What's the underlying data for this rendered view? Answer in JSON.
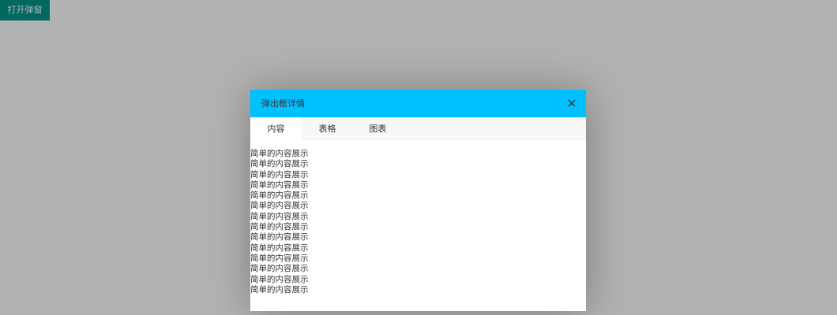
{
  "page": {
    "open_button_label": "打开弹窗"
  },
  "dialog": {
    "title": "弹出框详情",
    "close_icon": "close-icon",
    "tabs": [
      {
        "label": "内容",
        "active": true
      },
      {
        "label": "表格",
        "active": false
      },
      {
        "label": "图表",
        "active": false
      }
    ],
    "content_lines": [
      "简单的内容展示",
      "简单的内容展示",
      "简单的内容展示",
      "简单的内容展示",
      "简单的内容展示",
      "简单的内容展示",
      "简单的内容展示",
      "简单的内容展示",
      "简单的内容展示",
      "简单的内容展示",
      "简单的内容展示",
      "简单的内容展示",
      "简单的内容展示",
      "简单的内容展示"
    ]
  },
  "colors": {
    "open_button": "#009688",
    "dialog_header": "#00c0ff",
    "overlay": "rgba(0,0,0,0.3)"
  }
}
